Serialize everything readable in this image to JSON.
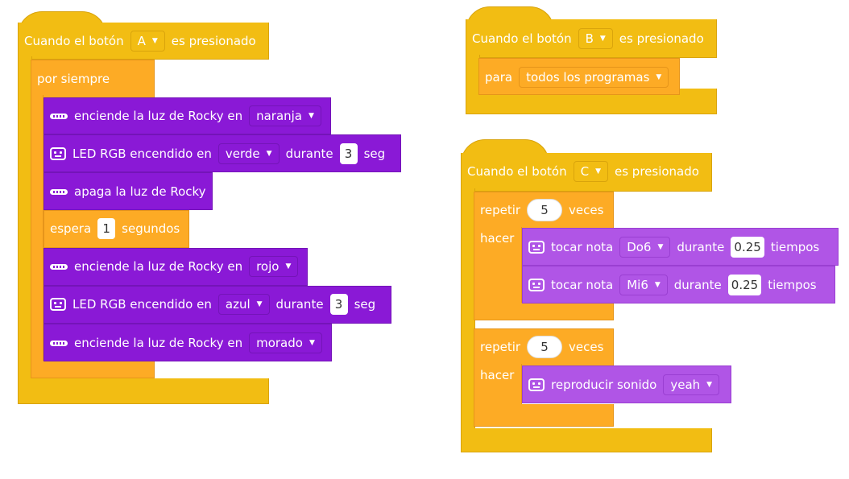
{
  "script_a": {
    "hat_prefix": "Cuando el botón",
    "hat_button": "A",
    "hat_suffix": "es presionado",
    "forever_label": "por siempre",
    "blocks": [
      {
        "text": "enciende la luz de Rocky en",
        "option": "naranja"
      },
      {
        "text": "LED RGB encendido en",
        "option": "verde",
        "mid": "durante",
        "value": "3",
        "unit": "seg"
      },
      {
        "text": "apaga la luz de Rocky"
      },
      {
        "text": "espera",
        "value": "1",
        "unit": "segundos"
      },
      {
        "text": "enciende la luz de Rocky en",
        "option": "rojo"
      },
      {
        "text": "LED RGB encendido en",
        "option": "azul",
        "mid": "durante",
        "value": "3",
        "unit": "seg"
      },
      {
        "text": "enciende la luz de Rocky en",
        "option": "morado"
      }
    ]
  },
  "script_b": {
    "hat_prefix": "Cuando el botón",
    "hat_button": "B",
    "hat_suffix": "es presionado",
    "para_label": "para",
    "para_option": "todos los programas"
  },
  "script_c": {
    "hat_prefix": "Cuando el botón",
    "hat_button": "C",
    "hat_suffix": "es presionado",
    "repeat1": {
      "label": "repetir",
      "count": "5",
      "unit": "veces",
      "do": "hacer"
    },
    "note1": {
      "text": "tocar nota",
      "note": "Do6",
      "mid": "durante",
      "value": "0.25",
      "unit": "tiempos"
    },
    "note2": {
      "text": "tocar nota",
      "note": "Mi6",
      "mid": "durante",
      "value": "0.25",
      "unit": "tiempos"
    },
    "repeat2": {
      "label": "repetir",
      "count": "5",
      "unit": "veces",
      "do": "hacer"
    },
    "sound": {
      "text": "reproducir sonido",
      "option": "yeah"
    }
  },
  "colors": {
    "event_yellow": "#f2bd13",
    "control_orange": "#fdab25",
    "light_purple": "#8a19d6",
    "sound_lavender": "#b055e6"
  },
  "icons": [
    "led-strip-icon",
    "rgb-led-icon",
    "speaker-board-icon"
  ]
}
